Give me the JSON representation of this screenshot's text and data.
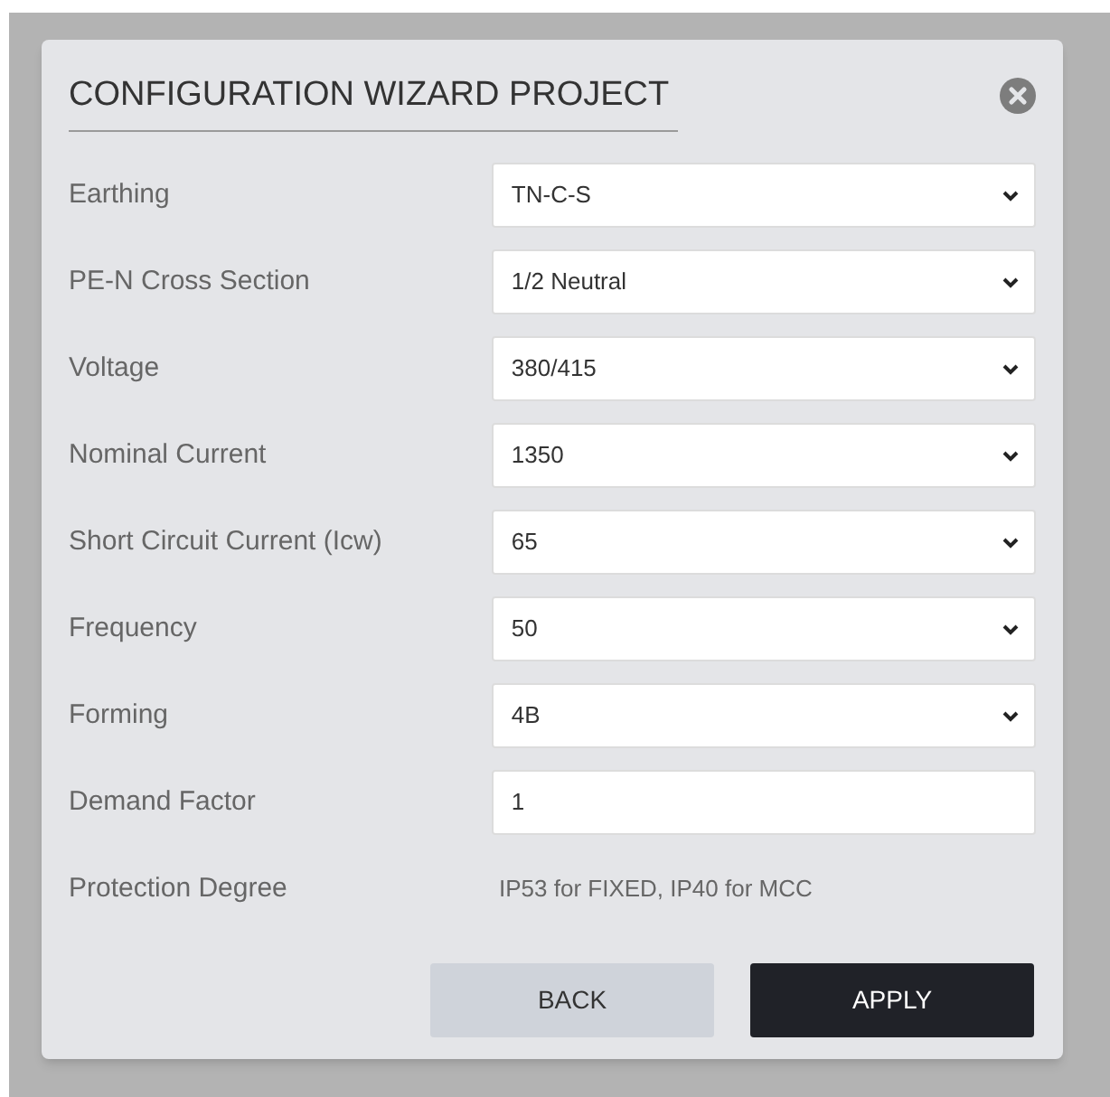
{
  "dialog": {
    "title": "CONFIGURATION WIZARD PROJECT"
  },
  "fields": [
    {
      "label": "Earthing",
      "kind": "select",
      "value": "TN-C-S"
    },
    {
      "label": "PE-N Cross Section",
      "kind": "select",
      "value": "1/2 Neutral"
    },
    {
      "label": "Voltage",
      "kind": "select",
      "value": "380/415"
    },
    {
      "label": "Nominal Current",
      "kind": "select",
      "value": "1350"
    },
    {
      "label": "Short Circuit Current (Icw)",
      "kind": "select",
      "value": "65"
    },
    {
      "label": "Frequency",
      "kind": "select",
      "value": "50"
    },
    {
      "label": "Forming",
      "kind": "select",
      "value": "4B"
    },
    {
      "label": "Demand Factor",
      "kind": "input",
      "value": "1"
    },
    {
      "label": "Protection Degree",
      "kind": "text",
      "value": "IP53 for FIXED, IP40 for MCC"
    }
  ],
  "buttons": [
    {
      "label": "BACK",
      "kind": "secondary"
    },
    {
      "label": "APPLY",
      "kind": "primary"
    }
  ]
}
